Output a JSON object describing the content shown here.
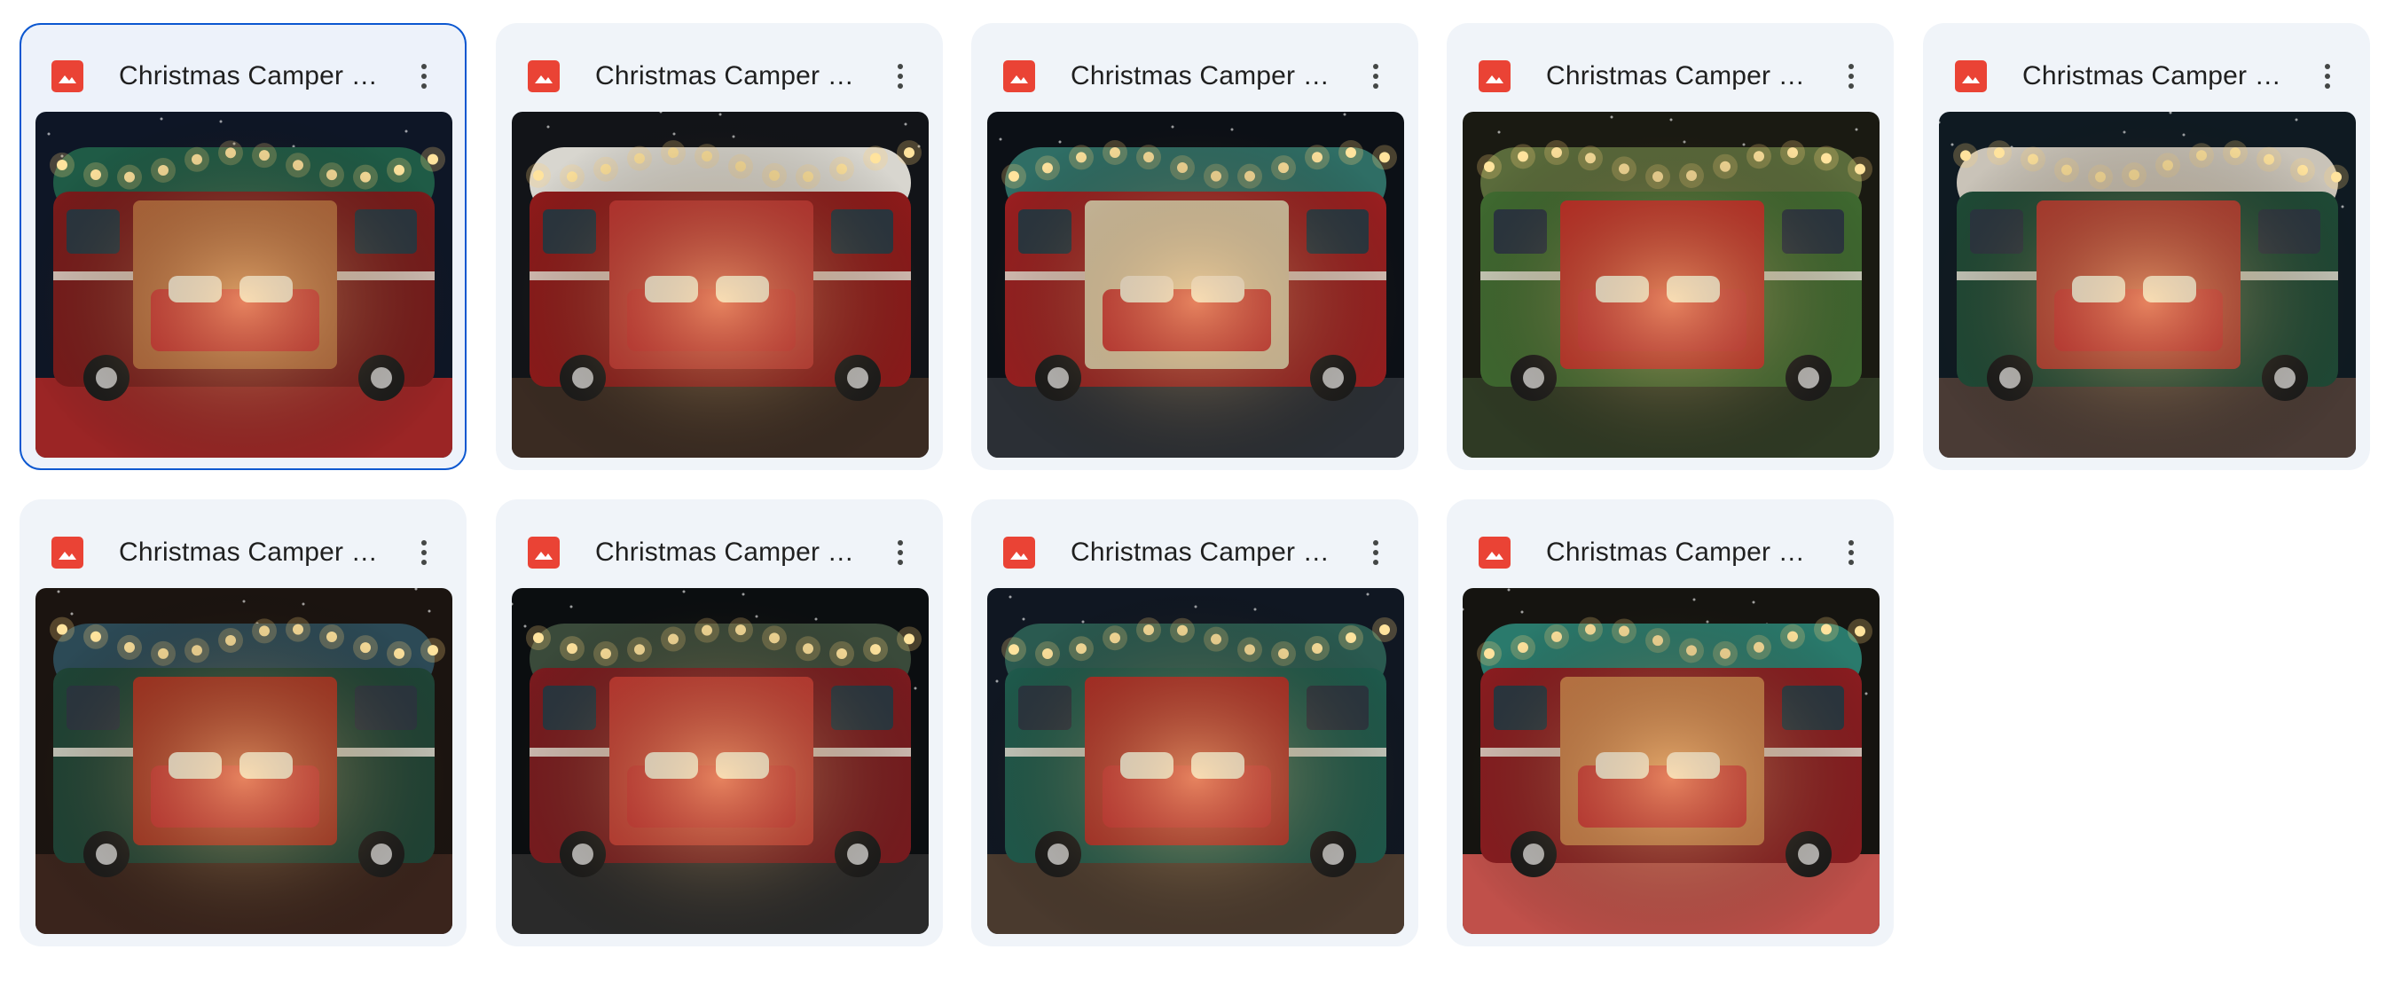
{
  "files": [
    {
      "name": "Christmas Camper B...",
      "icon": "image-file-icon",
      "selected": true,
      "palette": {
        "body": "#7a1b1b",
        "top": "#1f5b46",
        "inside": "#b5673a",
        "bg": "#0e1626",
        "floor": "#9b2525"
      }
    },
    {
      "name": "Christmas Camper B...",
      "icon": "image-file-icon",
      "selected": false,
      "palette": {
        "body": "#8e1a1a",
        "top": "#d8d6cf",
        "inside": "#c0302e",
        "bg": "#121418",
        "floor": "#3a2b22"
      }
    },
    {
      "name": "Christmas Camper B...",
      "icon": "image-file-icon",
      "selected": false,
      "palette": {
        "body": "#9a1f20",
        "top": "#2f6e65",
        "inside": "#d9c8a8",
        "bg": "#0c1016",
        "floor": "#2b2f35"
      }
    },
    {
      "name": "Christmas Camper B...",
      "icon": "image-file-icon",
      "selected": false,
      "palette": {
        "body": "#3f6a30",
        "top": "#5a6b3b",
        "inside": "#c22b24",
        "bg": "#1a1a12",
        "floor": "#2f3a24"
      }
    },
    {
      "name": "Christmas Camper B...",
      "icon": "image-file-icon",
      "selected": false,
      "palette": {
        "body": "#1f4a36",
        "top": "#c9c3b8",
        "inside": "#b3392e",
        "bg": "#0f1a22",
        "floor": "#4a3b35"
      }
    },
    {
      "name": "Christmas Camper B...",
      "icon": "image-file-icon",
      "selected": false,
      "palette": {
        "body": "#1f4436",
        "top": "#2c4a56",
        "inside": "#a8301f",
        "bg": "#1b1410",
        "floor": "#3a241c"
      }
    },
    {
      "name": "Christmas Camper B...",
      "icon": "image-file-icon",
      "selected": false,
      "palette": {
        "body": "#7a1b1f",
        "top": "#3a4a3a",
        "inside": "#c4352f",
        "bg": "#0b0e10",
        "floor": "#2a2a2a"
      }
    },
    {
      "name": "Christmas Camper B...",
      "icon": "image-file-icon",
      "selected": false,
      "palette": {
        "body": "#1f5a4c",
        "top": "#2a5a50",
        "inside": "#b02a23",
        "bg": "#101722",
        "floor": "#4a3a2e"
      }
    },
    {
      "name": "Christmas Camper B...",
      "icon": "image-file-icon",
      "selected": false,
      "palette": {
        "body": "#8a1c20",
        "top": "#2a7a6c",
        "inside": "#c87a45",
        "bg": "#151410",
        "floor": "#c0504a"
      }
    }
  ],
  "menu_icon": "more-vert-icon"
}
